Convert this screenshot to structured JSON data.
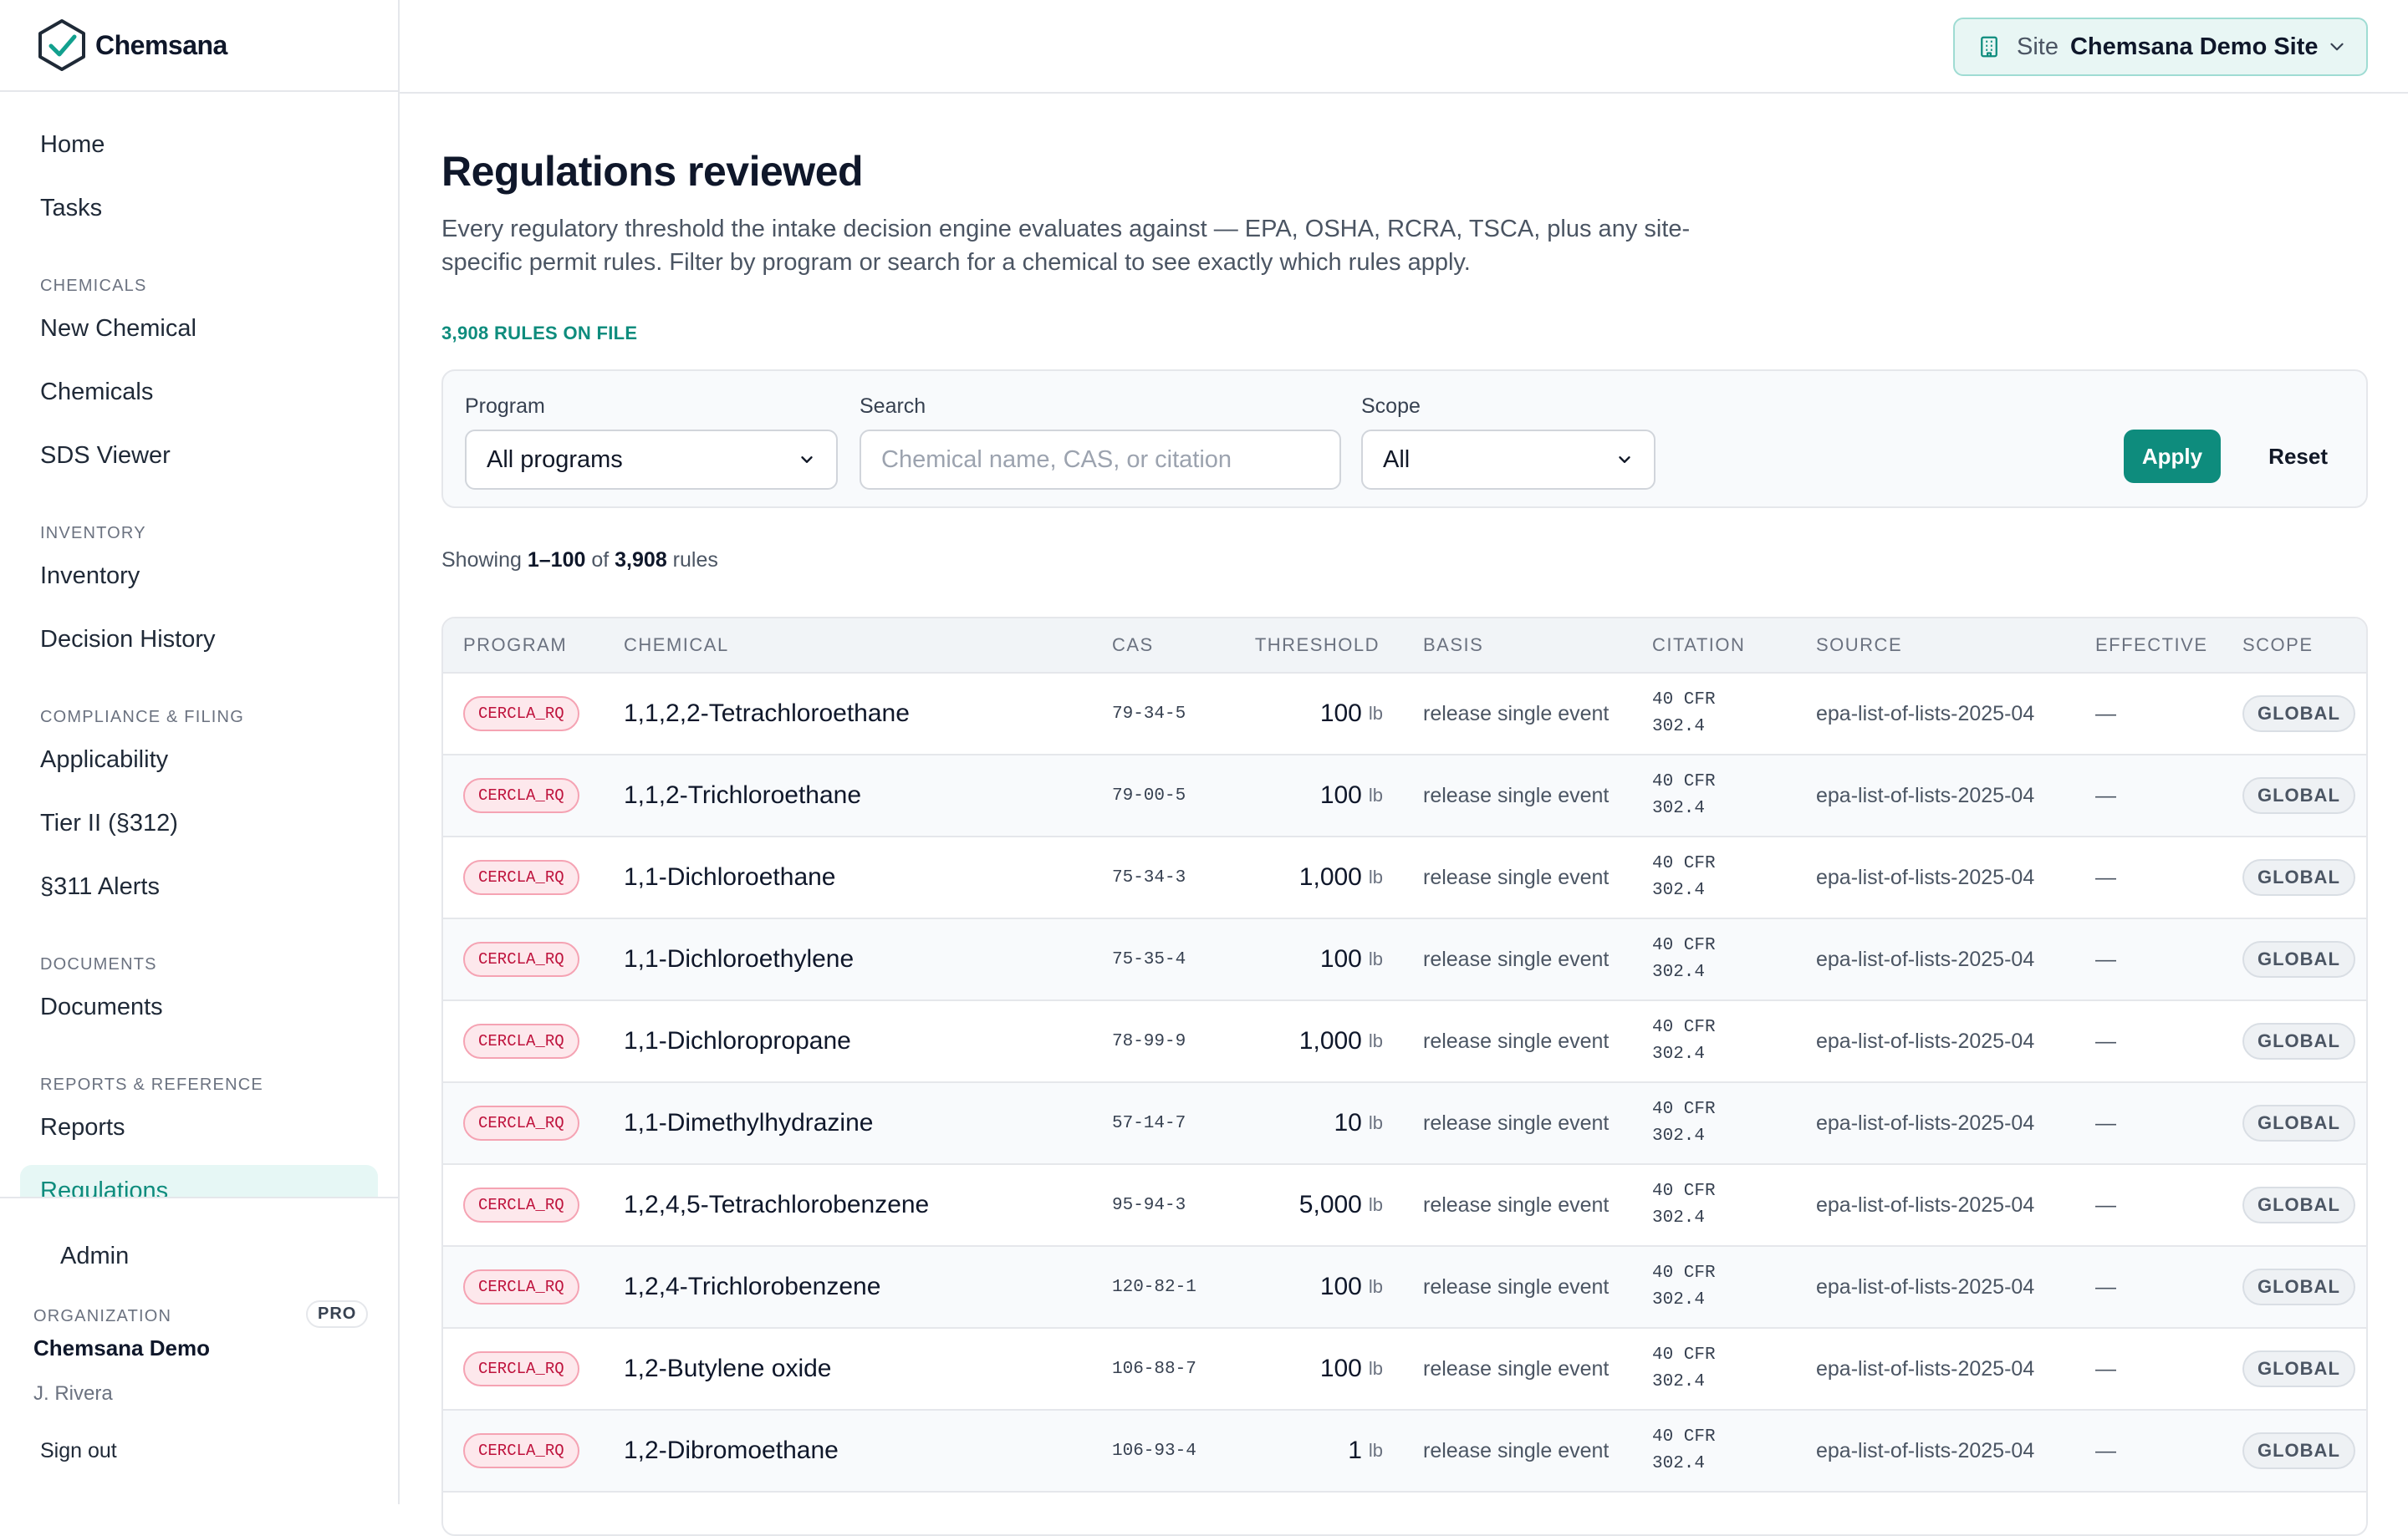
{
  "brand": {
    "name": "Chemsana"
  },
  "sidebar": {
    "items": [
      {
        "kind": "item",
        "label": "Home"
      },
      {
        "kind": "item",
        "label": "Tasks"
      },
      {
        "kind": "section",
        "label": "CHEMICALS"
      },
      {
        "kind": "item",
        "label": "New Chemical"
      },
      {
        "kind": "item",
        "label": "Chemicals"
      },
      {
        "kind": "item",
        "label": "SDS Viewer"
      },
      {
        "kind": "section",
        "label": "INVENTORY"
      },
      {
        "kind": "item",
        "label": "Inventory"
      },
      {
        "kind": "item",
        "label": "Decision History"
      },
      {
        "kind": "section",
        "label": "COMPLIANCE & FILING"
      },
      {
        "kind": "item",
        "label": "Applicability"
      },
      {
        "kind": "item",
        "label": "Tier II (§312)"
      },
      {
        "kind": "item",
        "label": "§311 Alerts"
      },
      {
        "kind": "section",
        "label": "DOCUMENTS"
      },
      {
        "kind": "item",
        "label": "Documents"
      },
      {
        "kind": "section",
        "label": "REPORTS & REFERENCE"
      },
      {
        "kind": "item",
        "label": "Reports"
      },
      {
        "kind": "item",
        "label": "Regulations",
        "active": true
      }
    ],
    "admin_label": "Admin",
    "org_label": "ORGANIZATION",
    "plan_badge": "PRO",
    "org_name": "Chemsana Demo",
    "user_name": "J. Rivera",
    "sign_out_label": "Sign out"
  },
  "header": {
    "site_label": "Site",
    "site_value": "Chemsana Demo Site",
    "accent_color": "#0e8c7d"
  },
  "main": {
    "title": "Regulations reviewed",
    "description": "Every regulatory threshold the intake decision engine evaluates against — EPA, OSHA, RCRA, TSCA, plus any site-specific permit rules. Filter by program or search for a chemical to see exactly which rules apply.",
    "rules_count": "3,908 RULES ON FILE"
  },
  "filters": {
    "program_label": "Program",
    "program_value": "All programs",
    "search_label": "Search",
    "search_placeholder": "Chemical name, CAS, or citation",
    "scope_label": "Scope",
    "scope_value": "All",
    "apply_label": "Apply",
    "reset_label": "Reset"
  },
  "showing": {
    "prefix": "Showing",
    "range": "1–100",
    "of": "of",
    "total": "3,908",
    "suffix": "rules"
  },
  "table": {
    "columns": [
      "PROGRAM",
      "CHEMICAL",
      "CAS",
      "THRESHOLD",
      "BASIS",
      "CITATION",
      "SOURCE",
      "EFFECTIVE",
      "SCOPE"
    ],
    "rows": [
      {
        "program": "CERCLA_RQ",
        "chemical": "1,1,2,2-Tetrachloroethane",
        "cas": "79-34-5",
        "threshold": "100",
        "unit": "lb",
        "basis": "release single event",
        "citation": "40 CFR 302.4",
        "source": "epa-list-of-lists-2025-04",
        "effective": "—",
        "scope": "GLOBAL"
      },
      {
        "program": "CERCLA_RQ",
        "chemical": "1,1,2-Trichloroethane",
        "cas": "79-00-5",
        "threshold": "100",
        "unit": "lb",
        "basis": "release single event",
        "citation": "40 CFR 302.4",
        "source": "epa-list-of-lists-2025-04",
        "effective": "—",
        "scope": "GLOBAL"
      },
      {
        "program": "CERCLA_RQ",
        "chemical": "1,1-Dichloroethane",
        "cas": "75-34-3",
        "threshold": "1,000",
        "unit": "lb",
        "basis": "release single event",
        "citation": "40 CFR 302.4",
        "source": "epa-list-of-lists-2025-04",
        "effective": "—",
        "scope": "GLOBAL"
      },
      {
        "program": "CERCLA_RQ",
        "chemical": "1,1-Dichloroethylene",
        "cas": "75-35-4",
        "threshold": "100",
        "unit": "lb",
        "basis": "release single event",
        "citation": "40 CFR 302.4",
        "source": "epa-list-of-lists-2025-04",
        "effective": "—",
        "scope": "GLOBAL"
      },
      {
        "program": "CERCLA_RQ",
        "chemical": "1,1-Dichloropropane",
        "cas": "78-99-9",
        "threshold": "1,000",
        "unit": "lb",
        "basis": "release single event",
        "citation": "40 CFR 302.4",
        "source": "epa-list-of-lists-2025-04",
        "effective": "—",
        "scope": "GLOBAL"
      },
      {
        "program": "CERCLA_RQ",
        "chemical": "1,1-Dimethylhydrazine",
        "cas": "57-14-7",
        "threshold": "10",
        "unit": "lb",
        "basis": "release single event",
        "citation": "40 CFR 302.4",
        "source": "epa-list-of-lists-2025-04",
        "effective": "—",
        "scope": "GLOBAL"
      },
      {
        "program": "CERCLA_RQ",
        "chemical": "1,2,4,5-Tetrachlorobenzene",
        "cas": "95-94-3",
        "threshold": "5,000",
        "unit": "lb",
        "basis": "release single event",
        "citation": "40 CFR 302.4",
        "source": "epa-list-of-lists-2025-04",
        "effective": "—",
        "scope": "GLOBAL"
      },
      {
        "program": "CERCLA_RQ",
        "chemical": "1,2,4-Trichlorobenzene",
        "cas": "120-82-1",
        "threshold": "100",
        "unit": "lb",
        "basis": "release single event",
        "citation": "40 CFR 302.4",
        "source": "epa-list-of-lists-2025-04",
        "effective": "—",
        "scope": "GLOBAL"
      },
      {
        "program": "CERCLA_RQ",
        "chemical": "1,2-Butylene oxide",
        "cas": "106-88-7",
        "threshold": "100",
        "unit": "lb",
        "basis": "release single event",
        "citation": "40 CFR 302.4",
        "source": "epa-list-of-lists-2025-04",
        "effective": "—",
        "scope": "GLOBAL"
      },
      {
        "program": "CERCLA_RQ",
        "chemical": "1,2-Dibromoethane",
        "cas": "106-93-4",
        "threshold": "1",
        "unit": "lb",
        "basis": "release single event",
        "citation": "40 CFR 302.4",
        "source": "epa-list-of-lists-2025-04",
        "effective": "—",
        "scope": "GLOBAL"
      }
    ]
  }
}
